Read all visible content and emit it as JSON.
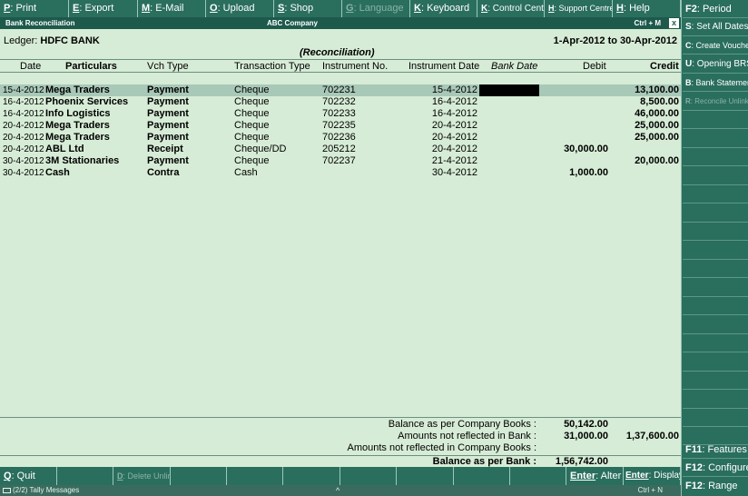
{
  "menu": [
    {
      "key": "P",
      "label": ": Print",
      "disabled": false
    },
    {
      "key": "E",
      "label": ": Export",
      "disabled": false
    },
    {
      "key": "M",
      "label": ": E-Mail",
      "disabled": false
    },
    {
      "key": "O",
      "label": ": Upload",
      "disabled": false
    },
    {
      "key": "S",
      "label": ": Shop",
      "disabled": false
    },
    {
      "key": "G",
      "label": ": Language",
      "disabled": true
    },
    {
      "key": "K",
      "label": ": Keyboard",
      "disabled": false
    },
    {
      "key": "K",
      "label": ": Control Centre",
      "disabled": false
    },
    {
      "key": "H",
      "label": ": Support Centre",
      "disabled": false
    },
    {
      "key": "H",
      "label": ": Help",
      "disabled": false
    }
  ],
  "title": {
    "left": "Bank Reconciliation",
    "center": "ABC Company",
    "right": "Ctrl + M",
    "close": "x"
  },
  "header": {
    "ledger_label": "Ledger:",
    "ledger_name": "HDFC BANK",
    "period": "1-Apr-2012 to 30-Apr-2012",
    "subtitle": "(Reconciliation)"
  },
  "columns": {
    "date": "Date",
    "particulars": "Particulars",
    "vch_type": "Vch Type",
    "transaction_type": "Transaction Type",
    "instrument_no": "Instrument No.",
    "instrument_date": "Instrument Date",
    "bank_date": "Bank Date",
    "debit": "Debit",
    "credit": "Credit"
  },
  "rows": [
    {
      "date": "15-4-2012",
      "particulars": "Mega Traders",
      "vch_type": "Payment",
      "transaction_type": "Cheque",
      "instrument_no": "702231",
      "instrument_date": "15-4-2012",
      "debit": "",
      "credit": "13,100.00",
      "selected": true
    },
    {
      "date": "16-4-2012",
      "particulars": "Phoenix Services",
      "vch_type": "Payment",
      "transaction_type": "Cheque",
      "instrument_no": "702232",
      "instrument_date": "16-4-2012",
      "debit": "",
      "credit": "8,500.00",
      "selected": false
    },
    {
      "date": "16-4-2012",
      "particulars": "Info Logistics",
      "vch_type": "Payment",
      "transaction_type": "Cheque",
      "instrument_no": "702233",
      "instrument_date": "16-4-2012",
      "debit": "",
      "credit": "46,000.00",
      "selected": false
    },
    {
      "date": "20-4-2012",
      "particulars": "Mega Traders",
      "vch_type": "Payment",
      "transaction_type": "Cheque",
      "instrument_no": "702235",
      "instrument_date": "20-4-2012",
      "debit": "",
      "credit": "25,000.00",
      "selected": false
    },
    {
      "date": "20-4-2012",
      "particulars": "Mega Traders",
      "vch_type": "Payment",
      "transaction_type": "Cheque",
      "instrument_no": "702236",
      "instrument_date": "20-4-2012",
      "debit": "",
      "credit": "25,000.00",
      "selected": false
    },
    {
      "date": "20-4-2012",
      "particulars": "ABL Ltd",
      "vch_type": "Receipt",
      "transaction_type": "Cheque/DD",
      "instrument_no": "205212",
      "instrument_date": "20-4-2012",
      "debit": "30,000.00",
      "credit": "",
      "selected": false
    },
    {
      "date": "30-4-2012",
      "particulars": "3M Stationaries",
      "vch_type": "Payment",
      "transaction_type": "Cheque",
      "instrument_no": "702237",
      "instrument_date": "21-4-2012",
      "debit": "",
      "credit": "20,000.00",
      "selected": false
    },
    {
      "date": "30-4-2012",
      "particulars": "Cash",
      "vch_type": "Contra",
      "transaction_type": "Cash",
      "instrument_no": "",
      "instrument_date": "30-4-2012",
      "debit": "1,000.00",
      "credit": "",
      "selected": false
    }
  ],
  "totals": {
    "company_books_label": "Balance as per Company Books :",
    "company_books_debit": "50,142.00",
    "not_in_bank_label": "Amounts not reflected in Bank :",
    "not_in_bank_debit": "31,000.00",
    "not_in_bank_credit": "1,37,600.00",
    "not_in_company_label": "Amounts not reflected in Company Books :",
    "bank_balance_label": "Balance as per Bank :",
    "bank_balance_debit": "1,56,742.00"
  },
  "bottom": {
    "quit_key": "Q",
    "quit_label": ": Quit",
    "delete_key": "D",
    "delete_label": ": Delete Unlinked",
    "alter_key": "Enter",
    "alter_label": ": Alter",
    "display_key": "Enter",
    "display_label": ": Display"
  },
  "status": {
    "messages": "(2/2) Tally Messages",
    "center": "^",
    "right": "Ctrl + N"
  },
  "right_panel": {
    "period": {
      "key": "F2",
      "label": ": Period"
    },
    "set_all_dates": {
      "key": "S",
      "label": ": Set All Dates"
    },
    "create_voucher": {
      "key": "C",
      "label": ": Create Voucher"
    },
    "opening_brs": {
      "key": "U",
      "label": ": Opening BRS"
    },
    "bank_statement": {
      "key": "B",
      "label": ": Bank Statement"
    },
    "reconcile_unlinked": {
      "key": "R",
      "label": ": Reconcile Unlinked"
    },
    "features": {
      "key": "F11",
      "label": ": Features"
    },
    "configure": {
      "key": "F12",
      "label": ": Configure"
    },
    "range": {
      "key": "F12",
      "label": ": Range"
    }
  }
}
